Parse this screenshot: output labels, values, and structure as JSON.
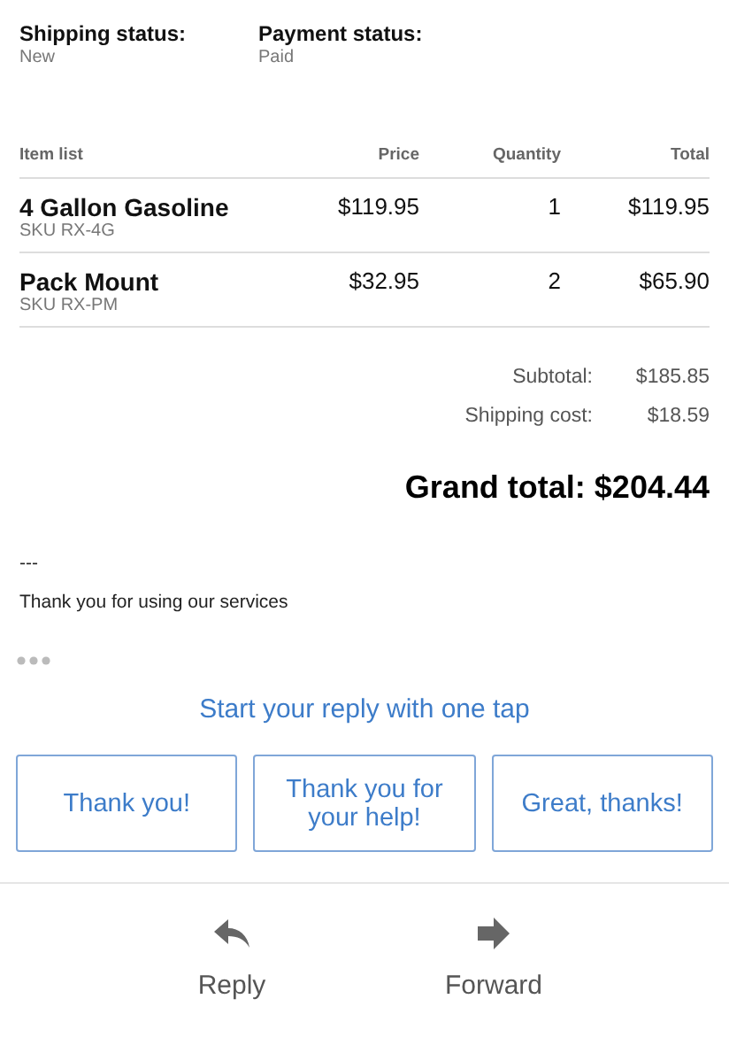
{
  "statuses": [
    {
      "label": "Shipping status:",
      "value": "New"
    },
    {
      "label": "Payment status:",
      "value": "Paid"
    }
  ],
  "table": {
    "columns": [
      "Item list",
      "Price",
      "Quantity",
      "Total"
    ],
    "rows": [
      {
        "name": "4 Gallon Gasoline",
        "sku": "SKU RX-4G",
        "price": "$119.95",
        "quantity": "1",
        "total": "$119.95"
      },
      {
        "name": "Pack Mount",
        "sku": "SKU RX-PM",
        "price": "$32.95",
        "quantity": "2",
        "total": "$65.90"
      }
    ]
  },
  "summary": [
    {
      "label": "Subtotal:",
      "value": "$185.85"
    },
    {
      "label": "Shipping cost:",
      "value": "$18.59"
    }
  ],
  "grand_total": "Grand total: $204.44",
  "signature": [
    "---",
    "Thank you for using our services"
  ],
  "smart_reply": {
    "title": "Start your reply with one tap",
    "options": [
      "Thank you!",
      "Thank you for your help!",
      "Great, thanks!"
    ]
  },
  "actions": [
    {
      "kind": "reply",
      "label": "Reply"
    },
    {
      "kind": "forward",
      "label": "Forward"
    }
  ]
}
